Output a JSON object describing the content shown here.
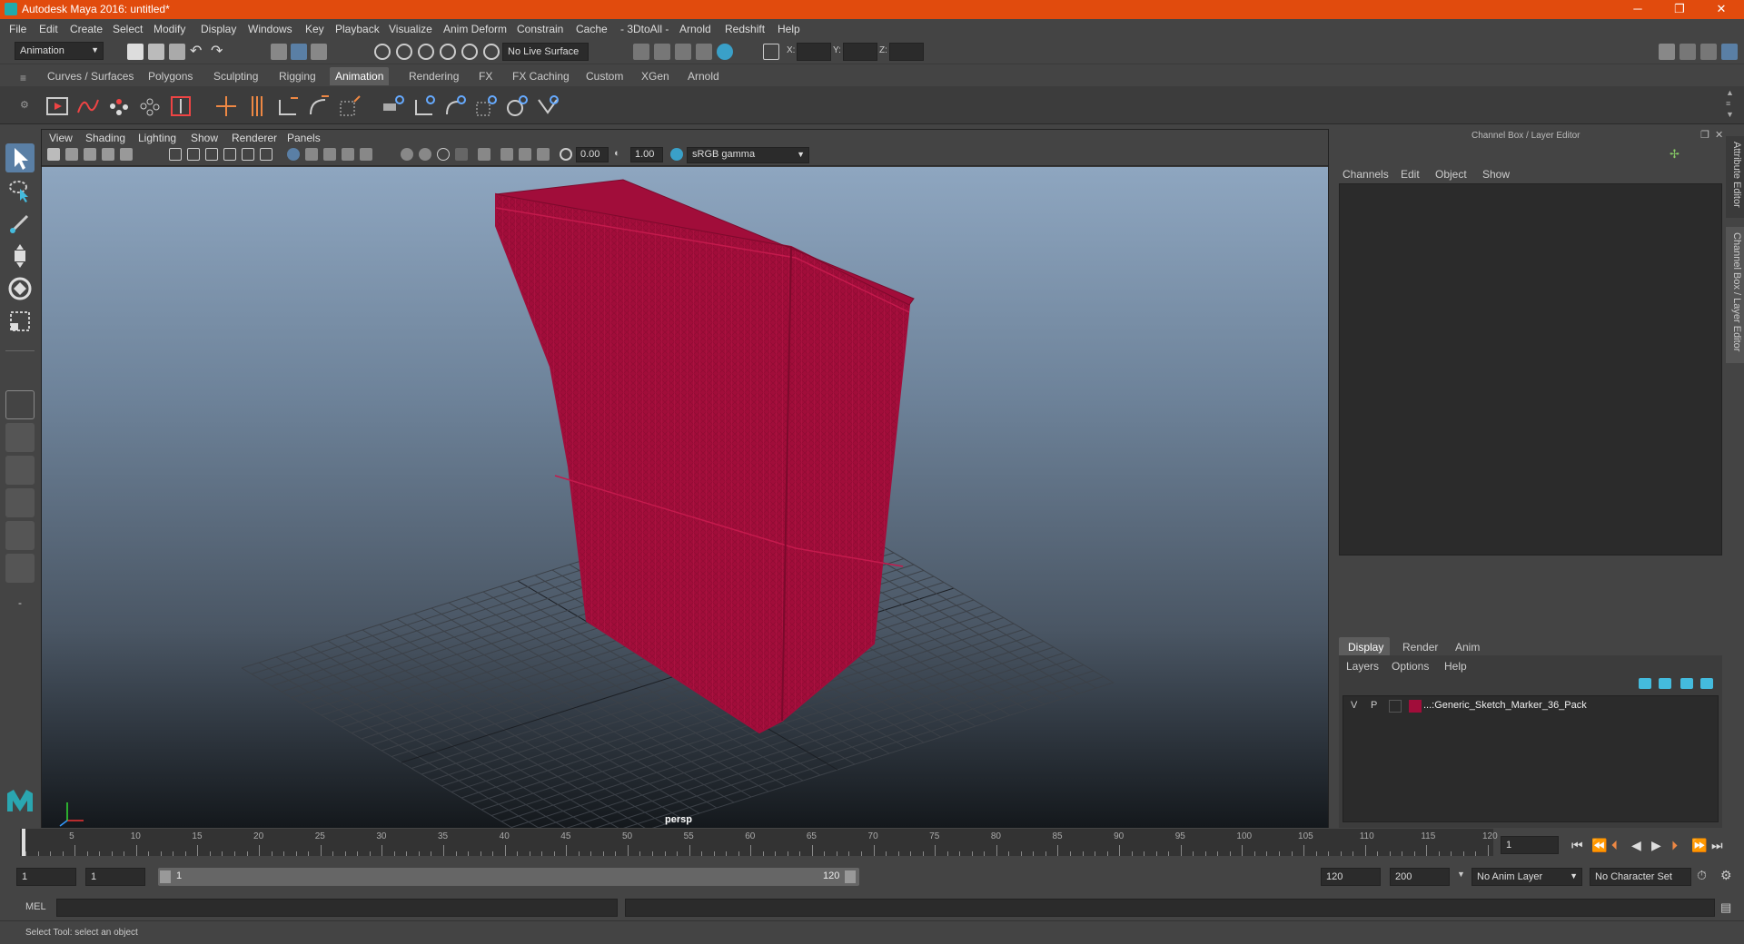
{
  "window": {
    "title": "Autodesk Maya 2016: untitled*",
    "minimize": "─",
    "restore": "❐",
    "close": "✕"
  },
  "menubar": [
    "File",
    "Edit",
    "Create",
    "Select",
    "Modify",
    "Display",
    "Windows",
    "Key",
    "Playback",
    "Visualize",
    "Anim Deform",
    "Constrain",
    "Cache",
    "- 3DtoAll -",
    "Arnold",
    "Redshift",
    "Help"
  ],
  "statusline": {
    "mode": "Animation",
    "live_surface": "No Live Surface",
    "x_label": "X:",
    "y_label": "Y:",
    "z_label": "Z:"
  },
  "shelf": {
    "tabs": [
      "Curves / Surfaces",
      "Polygons",
      "Sculpting",
      "Rigging",
      "Animation",
      "Rendering",
      "FX",
      "FX Caching",
      "Custom",
      "XGen",
      "Arnold"
    ],
    "active_tab": "Animation"
  },
  "viewport": {
    "menu": [
      "View",
      "Shading",
      "Lighting",
      "Show",
      "Renderer",
      "Panels"
    ],
    "exposure": "0.00",
    "gamma": "1.00",
    "colorspace": "sRGB gamma",
    "camera_label": "persp",
    "mesh_color": "#a10d3a"
  },
  "channelbox": {
    "title": "Channel Box / Layer Editor",
    "menu": [
      "Channels",
      "Edit",
      "Object",
      "Show"
    ]
  },
  "layer_editor": {
    "tabs": [
      "Display",
      "Render",
      "Anim"
    ],
    "active_tab": "Display",
    "menu": [
      "Layers",
      "Options",
      "Help"
    ],
    "layers": [
      {
        "v": "V",
        "p": "P",
        "color": "#a10d3a",
        "name": "...:Generic_Sketch_Marker_36_Pack"
      }
    ]
  },
  "side_tabs": {
    "attribute_editor": "Attribute Editor",
    "channel_box": "Channel Box / Layer Editor"
  },
  "timeslider": {
    "ticks": [
      "1",
      "5",
      "10",
      "15",
      "20",
      "25",
      "30",
      "35",
      "40",
      "45",
      "50",
      "55",
      "60",
      "65",
      "70",
      "75",
      "80",
      "85",
      "90",
      "95",
      "100",
      "105",
      "110",
      "115",
      "120"
    ],
    "current_frame": "1"
  },
  "range": {
    "start": "1",
    "anim_start": "1",
    "range_start_label": "1",
    "range_end_label": "120",
    "end": "120",
    "anim_end": "200",
    "anim_layer": "No Anim Layer",
    "character_set": "No Character Set"
  },
  "cmdline": {
    "label": "MEL"
  },
  "helpline": {
    "text": "Select Tool: select an object"
  }
}
